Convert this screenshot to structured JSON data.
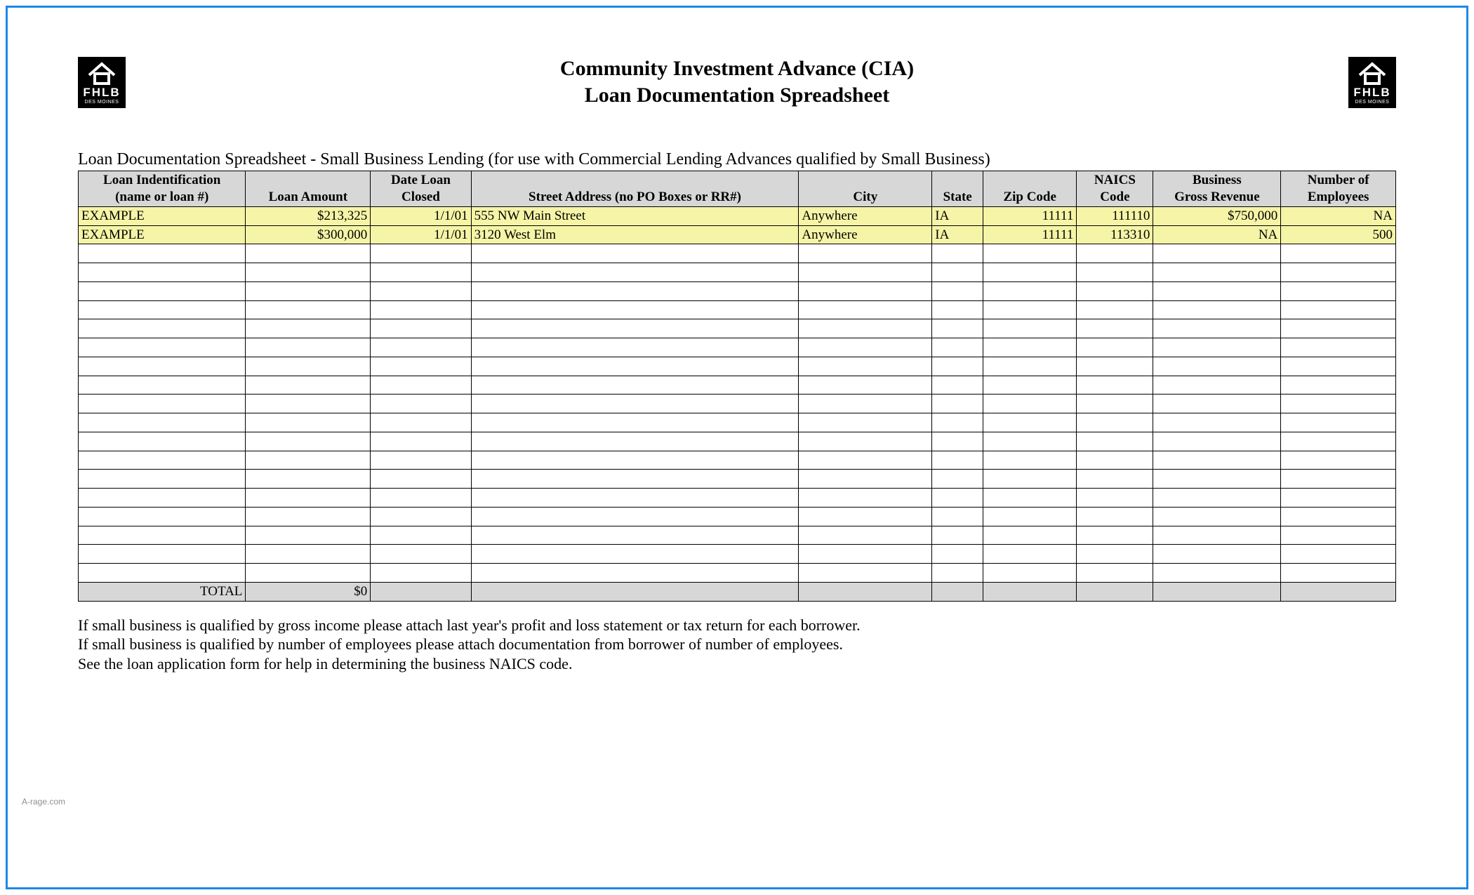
{
  "logo": {
    "line1": "FHLB",
    "line2": "DES MOINES"
  },
  "title": {
    "line1": "Community Investment Advance (CIA)",
    "line2": "Loan Documentation Spreadsheet"
  },
  "lead": "Loan Documentation Spreadsheet - Small Business Lending (for use with Commercial Lending Advances qualified by Small Business)",
  "columns": [
    {
      "line1": "Loan Indentification",
      "line2": "(name or loan #)"
    },
    {
      "line1": "",
      "line2": "Loan Amount"
    },
    {
      "line1": "Date Loan",
      "line2": "Closed"
    },
    {
      "line1": "",
      "line2": "Street Address (no PO Boxes or RR#)"
    },
    {
      "line1": "",
      "line2": "City"
    },
    {
      "line1": "",
      "line2": "State"
    },
    {
      "line1": "",
      "line2": "Zip Code"
    },
    {
      "line1": "NAICS",
      "line2": "Code"
    },
    {
      "line1": "Business",
      "line2": "Gross Revenue"
    },
    {
      "line1": "Number of",
      "line2": "Employees"
    }
  ],
  "rows": [
    {
      "loan_id": "EXAMPLE",
      "amount": "$213,325",
      "date": "1/1/01",
      "street": "555 NW Main Street",
      "city": "Anywhere",
      "state": "IA",
      "zip": "11111",
      "naics": "111110",
      "revenue": "$750,000",
      "employees": "NA"
    },
    {
      "loan_id": "EXAMPLE",
      "amount": "$300,000",
      "date": "1/1/01",
      "street": "3120 West Elm",
      "city": "Anywhere",
      "state": "IA",
      "zip": "11111",
      "naics": "113310",
      "revenue": "NA",
      "employees": "500"
    }
  ],
  "empty_row_count": 18,
  "total": {
    "label": "TOTAL",
    "amount": "$0"
  },
  "notes": [
    "If small business is qualified by gross income please attach last year's profit and loss statement or tax return for each borrower.",
    "If small business is qualified by number of employees please attach documentation from borrower of number of employees.",
    "See the loan application form for help in determining the business NAICS code."
  ],
  "watermark": "A-rage.com"
}
